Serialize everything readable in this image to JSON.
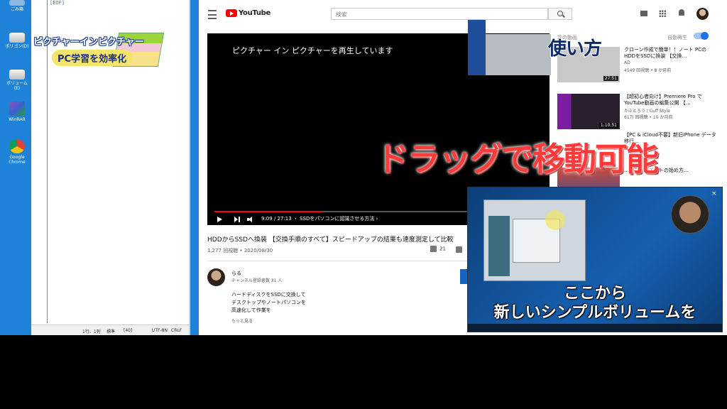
{
  "desktop": {
    "icons": [
      {
        "label": "ごみ箱",
        "icon": "recycle-bin-icon",
        "color": "#8fb8e0"
      },
      {
        "label": "ポリゴン(D)",
        "icon": "drive-icon",
        "color": "#e8e8e8"
      },
      {
        "label": "ボリューム(E)",
        "icon": "drive-icon",
        "color": "#e8e8e8"
      },
      {
        "label": "WinRAR",
        "icon": "winrar-icon",
        "color": "#9b4fb5"
      },
      {
        "label": "Google Chrome",
        "icon": "chrome-icon",
        "color": "#4285f4"
      }
    ]
  },
  "notepad": {
    "code_line": "[EOF]",
    "status": {
      "pos": "1行、1列",
      "zoom": "標準",
      "count": "[40]",
      "encoding": "UTF-8N",
      "eol": "CRLF"
    }
  },
  "banner": {
    "line1": "ピクチャーインピクチャー",
    "line2": "PC学習を効率化"
  },
  "youtube": {
    "logo_text": "YouTube",
    "search_placeholder": "検索",
    "player": {
      "pip_message": "ピクチャー イン ピクチャーを再生しています",
      "info_icon": "i",
      "progress_fraction": 0.33,
      "time_text": "9:09 / 27:13 ・ SSDをパソコンに認識させる方法 ›"
    },
    "video": {
      "title": "HDDからSSDへ換装 【交換手順のすべて】スピードアップの結果も速度測定して比較",
      "meta": "1,277 回視聴 • 2020/08/30",
      "likes": "21"
    },
    "channel": {
      "name": "らる",
      "subscribers": "チャンネル登録者数 31 人",
      "description": [
        "ハードディスクをSSDに交換して",
        "デスクトップやノートパソコンを",
        "高速化して作業を"
      ],
      "more": "もっと見る"
    },
    "sidebar": {
      "up_next": "次の動画",
      "autoplay": "自動再生",
      "cards": [
        {
          "title": "クローン作成で簡単！！ノート PCのHDDをSSDに換装 【交換…",
          "channel": "AD",
          "views": "4549 回視聴 • 8 か月前",
          "duration": "27:51",
          "thumb_color": "#c8c8c8"
        },
        {
          "title": "【超初心者向け】Premiere Pro でYouTube動画の編集公開 【…",
          "channel": "かぶとろう / Cuff Style",
          "views": "61万 回視聴 • 10 か月前",
          "duration": "1:10:51",
          "thumb_color": "#2a1f2e"
        },
        {
          "title": "【PC & iCloud不要】新旧iPhone データ移行…",
          "channel": "",
          "views": "",
          "duration": "",
          "thumb_color": "#ffffff"
        },
        {
          "title": "…アフィリエイトの始め方…",
          "channel": "",
          "views": "",
          "duration": "",
          "thumb_color": "#d04a3a"
        }
      ]
    }
  },
  "overlays": {
    "usage": "使い方",
    "drag_text": "ドラッグで移動可能",
    "pip_caption_line1": "ここから",
    "pip_caption_line2": "新しいシンプルボリュームを",
    "pip_close": "×"
  },
  "colors": {
    "accent_red": "#ff0000",
    "desktop_blue": "#1e82d8",
    "overlay_red": "#ff3a3a"
  }
}
